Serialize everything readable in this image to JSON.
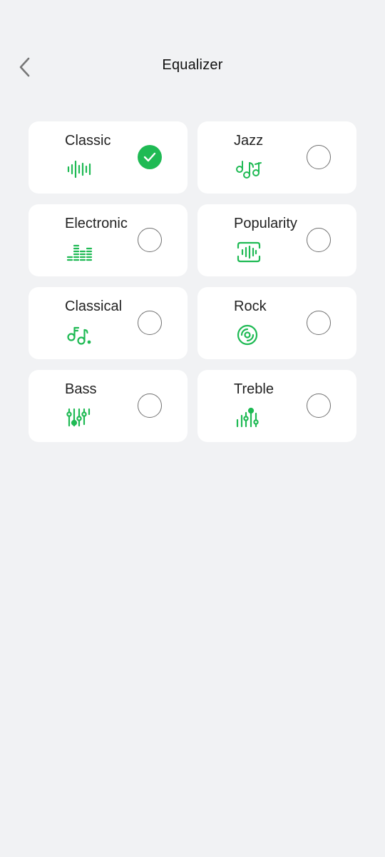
{
  "header": {
    "title": "Equalizer",
    "back_icon": "chevron-left-icon"
  },
  "accent_color": "#1fba54",
  "presets": [
    {
      "label": "Classic",
      "icon": "waveform-icon",
      "selected": true
    },
    {
      "label": "Jazz",
      "icon": "music-notes-icon",
      "selected": false
    },
    {
      "label": "Electronic",
      "icon": "equalizer-bars-icon",
      "selected": false
    },
    {
      "label": "Popularity",
      "icon": "audio-wave-frame-icon",
      "selected": false
    },
    {
      "label": "Classical",
      "icon": "double-note-icon",
      "selected": false
    },
    {
      "label": "Rock",
      "icon": "vinyl-disc-icon",
      "selected": false
    },
    {
      "label": "Bass",
      "icon": "sliders-icon",
      "selected": false
    },
    {
      "label": "Treble",
      "icon": "sliders-up-icon",
      "selected": false
    }
  ]
}
